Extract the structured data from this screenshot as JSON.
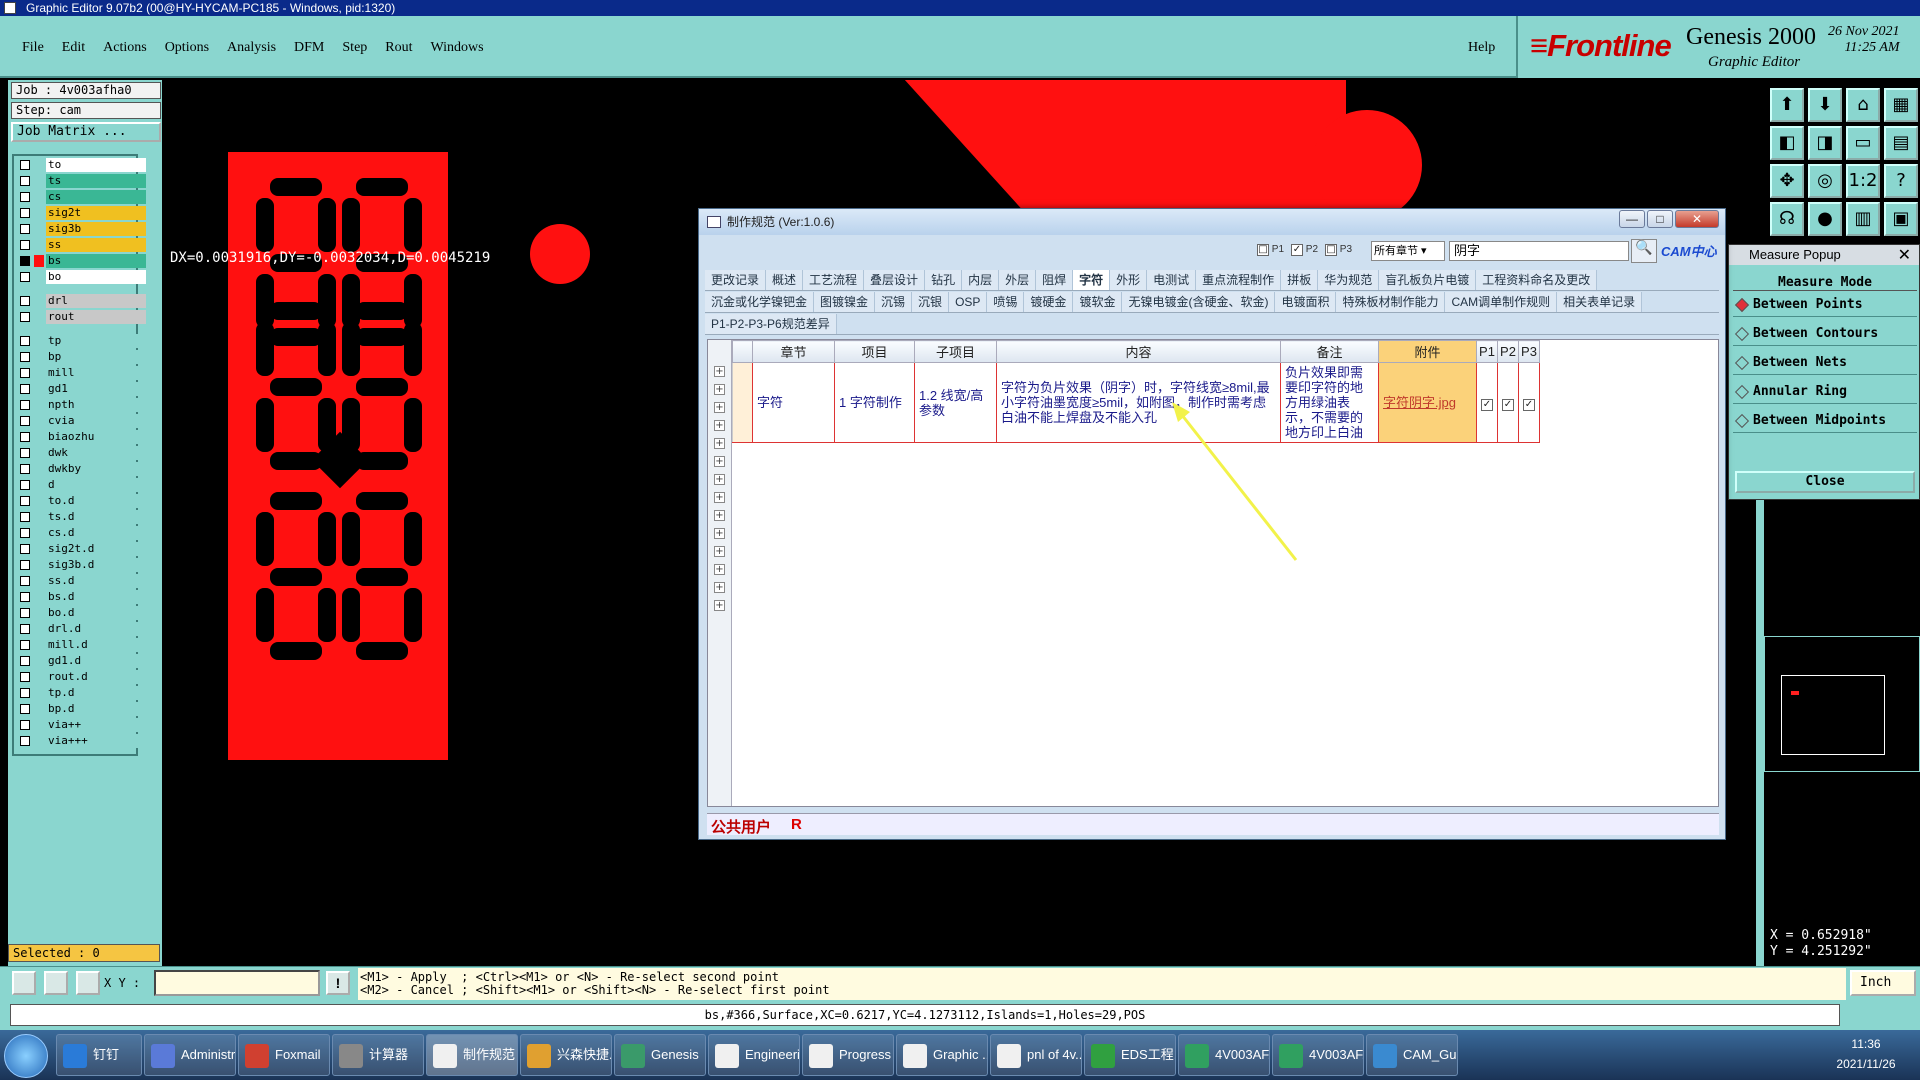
{
  "window": {
    "title": "Graphic Editor 9.07b2 (00@HY-HYCAM-PC185 - Windows, pid:1320)"
  },
  "menu": {
    "items": [
      "File",
      "Edit",
      "Actions",
      "Options",
      "Analysis",
      "DFM",
      "Step",
      "Rout",
      "Windows"
    ],
    "help": "Help"
  },
  "brand": {
    "logo": "Frontline",
    "product": "Genesis 2000",
    "subtitle": "Graphic Editor",
    "date": "26 Nov 2021",
    "time": "11:25 AM"
  },
  "job": {
    "job": "Job : 4v003afha0",
    "step": "Step: cam",
    "matrix_btn": "Job Matrix ..."
  },
  "layers": [
    {
      "name": "to",
      "style": "w"
    },
    {
      "name": "ts",
      "style": "c"
    },
    {
      "name": "cs",
      "style": "c"
    },
    {
      "name": "sig2t",
      "style": "y"
    },
    {
      "name": "sig3b",
      "style": "y"
    },
    {
      "name": "ss",
      "style": "y"
    },
    {
      "name": "bs",
      "style": "c",
      "active": true
    },
    {
      "name": "bo",
      "style": "w"
    },
    {
      "name": "drl",
      "style": "g"
    },
    {
      "name": "rout",
      "style": "g"
    },
    {
      "name": "tp",
      "style": "t"
    },
    {
      "name": "bp",
      "style": "t"
    },
    {
      "name": "mill",
      "style": "t"
    },
    {
      "name": "gd1",
      "style": "t"
    },
    {
      "name": "npth",
      "style": "t"
    },
    {
      "name": "cvia",
      "style": "t"
    },
    {
      "name": "biaozhu",
      "style": "t"
    },
    {
      "name": "dwk",
      "style": "t"
    },
    {
      "name": "dwkby",
      "style": "t"
    },
    {
      "name": "d",
      "style": "t"
    },
    {
      "name": "to.d",
      "style": "t"
    },
    {
      "name": "ts.d",
      "style": "t"
    },
    {
      "name": "cs.d",
      "style": "t"
    },
    {
      "name": "sig2t.d",
      "style": "t"
    },
    {
      "name": "sig3b.d",
      "style": "t"
    },
    {
      "name": "ss.d",
      "style": "t"
    },
    {
      "name": "bs.d",
      "style": "t"
    },
    {
      "name": "bo.d",
      "style": "t"
    },
    {
      "name": "drl.d",
      "style": "t"
    },
    {
      "name": "mill.d",
      "style": "t"
    },
    {
      "name": "gd1.d",
      "style": "t"
    },
    {
      "name": "rout.d",
      "style": "t"
    },
    {
      "name": "tp.d",
      "style": "t"
    },
    {
      "name": "bp.d",
      "style": "t"
    },
    {
      "name": "via++",
      "style": "t"
    },
    {
      "name": "via+++",
      "style": "t"
    }
  ],
  "selected": "Selected : 0",
  "canvas": {
    "measure_readout": "DX=0.0031916,DY=-0.0032034,D=0.0045219"
  },
  "tools": [
    "⬆",
    "⬇",
    "⌂",
    "▦",
    "◧",
    "◨",
    "▭",
    "▤",
    "✥",
    "◎",
    "1:2",
    "?",
    "☊",
    "●",
    "▥",
    "▣"
  ],
  "measure": {
    "title": "Measure Popup",
    "mode_label": "Measure Mode",
    "options": [
      "Between Points",
      "Between Contours",
      "Between Nets",
      "Annular Ring",
      "Between Midpoints"
    ],
    "close": "Close"
  },
  "coords": {
    "x": "X = 0.652918\"",
    "y": "Y = 4.251292\""
  },
  "cmd": {
    "xy_label": "X Y :",
    "input_value": "",
    "help_line1": "<M1> - Apply  ; <Ctrl><M1> or <N> - Re-select second point",
    "help_line2": "<M2> - Cancel ; <Shift><M1> or <Shift><N> - Re-select first point",
    "unit": "Inch"
  },
  "status": "bs,#366,Surface,XC=0.6217,YC=4.1273112,Islands=1,Holes=29,POS",
  "dialog": {
    "title": "制作规范 (Ver:1.0.6)",
    "checks": [
      "P1",
      "P2",
      "P3"
    ],
    "chapter_select": "所有章节",
    "search_value": "阴字",
    "cam_logo": "CAM中心",
    "tab_rows": [
      [
        "更改记录",
        "概述",
        "工艺流程",
        "叠层设计",
        "钻孔",
        "内层",
        "外层",
        "阻焊",
        "字符",
        "外形",
        "电测试",
        "重点流程制作",
        "拼板",
        "华为规范",
        "盲孔板负片电镀",
        "工程资料命名及更改"
      ],
      [
        "沉金或化学镍钯金",
        "图镀镍金",
        "沉锡",
        "沉银",
        "OSP",
        "喷锡",
        "镀硬金",
        "镀软金",
        "无镍电镀金(含硬金、软金)",
        "电镀面积",
        "特殊板材制作能力",
        "CAM调单制作规则",
        "相关表单记录"
      ],
      [
        "P1-P2-P3-P6规范差异"
      ]
    ],
    "active_tab": "字符",
    "columns": [
      "章节",
      "项目",
      "子项目",
      "内容",
      "备注",
      "附件",
      "P1",
      "P2",
      "P3"
    ],
    "rows": [
      {
        "chapter": "字符",
        "item": "1 字符制作",
        "sub": "1.2 线宽/高参数",
        "content": "字符为负片效果（阴字）时，字符线宽≥8mil,最小字符油墨宽度≥5mil，如附图，制作时需考虑白油不能上焊盘及不能入孔",
        "note": "负片效果即需要印字符的地方用绿油表示，不需要的地方印上白油",
        "attachment": "字符阴字.jpg",
        "p1": "✓",
        "p2": "✓",
        "p3": "✓"
      }
    ],
    "footer_user": "公共用户",
    "footer_r": "R"
  },
  "taskbar": {
    "items": [
      "钉钉",
      "Administr...",
      "Foxmail",
      "计算器",
      "制作规范 ...",
      "兴森快捷...",
      "Genesis",
      "Engineeri...",
      "Progress",
      "Graphic ...",
      "pnl of 4v...",
      "EDS工程...",
      "4V003AF...",
      "4V003AF...",
      "CAM_Gui..."
    ],
    "time": "11:36",
    "date": "2021/11/26"
  }
}
